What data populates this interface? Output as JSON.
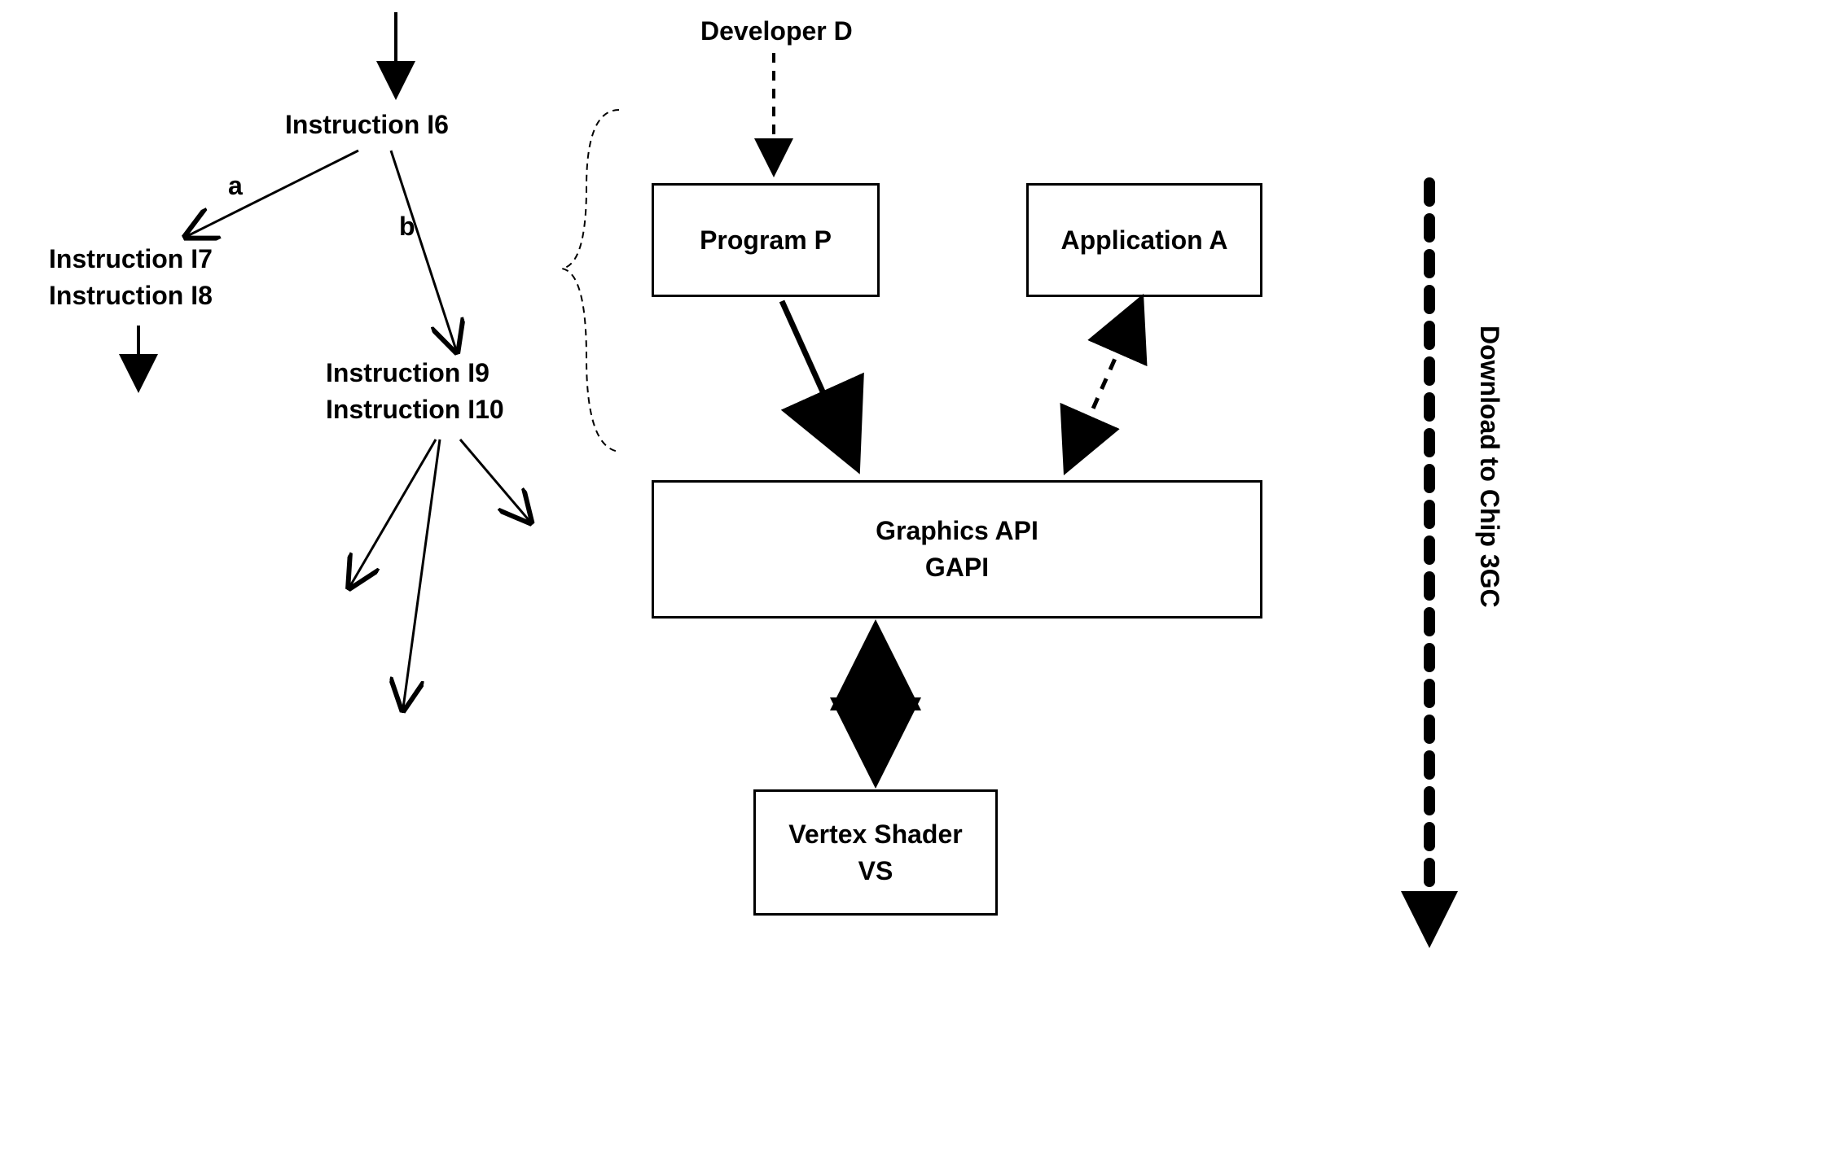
{
  "instructions": {
    "i6": "Instruction I6",
    "i7": "Instruction I7",
    "i8": "Instruction I8",
    "i9": "Instruction I9",
    "i10": "Instruction I10"
  },
  "branches": {
    "a": "a",
    "b": "b"
  },
  "nodes": {
    "developer": "Developer D",
    "program": "Program P",
    "application": "Application A",
    "gapi_line1": "Graphics API",
    "gapi_line2": "GAPI",
    "vertex_line1": "Vertex Shader",
    "vertex_line2": "VS"
  },
  "sidebar": "Download to Chip 3GC"
}
